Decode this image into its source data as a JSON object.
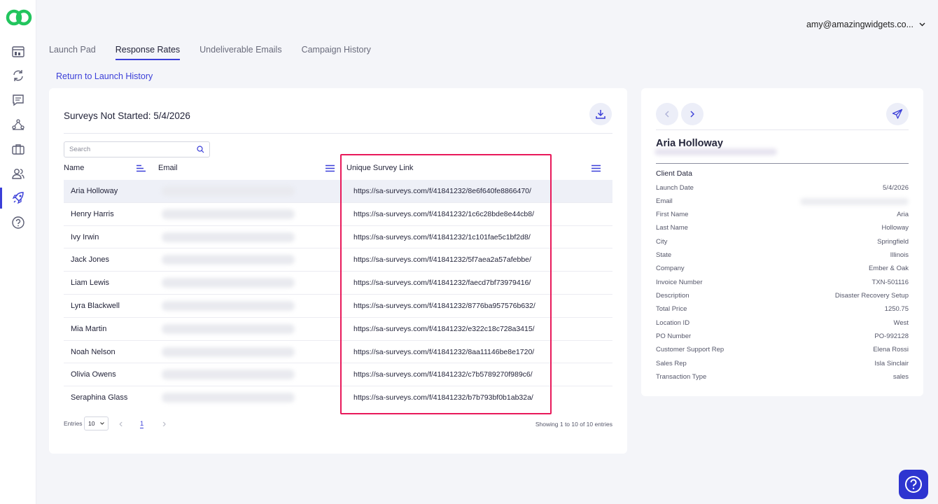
{
  "user": {
    "email": "amy@amazingwidgets.co..."
  },
  "nav": [
    "dashboard-icon",
    "sync-icon",
    "chat-icon",
    "network-icon",
    "briefcase-icon",
    "users-icon",
    "rocket-icon",
    "help-icon"
  ],
  "tabs": [
    {
      "label": "Launch Pad"
    },
    {
      "label": "Response Rates"
    },
    {
      "label": "Undeliverable Emails"
    },
    {
      "label": "Campaign History"
    }
  ],
  "return_link": "Return to Launch History",
  "main": {
    "title": "Surveys Not Started: 5/4/2026",
    "search_placeholder": "Search",
    "columns": {
      "name": "Name",
      "email": "Email",
      "link": "Unique Survey Link"
    },
    "rows": [
      {
        "name": "Aria Holloway",
        "link": "https://sa-surveys.com/f/41841232/8e6f640fe8866470/"
      },
      {
        "name": "Henry Harris",
        "link": "https://sa-surveys.com/f/41841232/1c6c28bde8e44cb8/"
      },
      {
        "name": "Ivy Irwin",
        "link": "https://sa-surveys.com/f/41841232/1c101fae5c1bf2d8/"
      },
      {
        "name": "Jack Jones",
        "link": "https://sa-surveys.com/f/41841232/5f7aea2a57afebbe/"
      },
      {
        "name": "Liam Lewis",
        "link": "https://sa-surveys.com/f/41841232/faecd7bf73979416/"
      },
      {
        "name": "Lyra Blackwell",
        "link": "https://sa-surveys.com/f/41841232/8776ba957576b632/"
      },
      {
        "name": "Mia Martin",
        "link": "https://sa-surveys.com/f/41841232/e322c18c728a3415/"
      },
      {
        "name": "Noah Nelson",
        "link": "https://sa-surveys.com/f/41841232/8aa11146be8e1720/"
      },
      {
        "name": "Olivia Owens",
        "link": "https://sa-surveys.com/f/41841232/c7b5789270f989c6/"
      },
      {
        "name": "Seraphina Glass",
        "link": "https://sa-surveys.com/f/41841232/b7b793bf0b1ab32a/"
      }
    ],
    "entries_label": "Entries",
    "entries_value": "10",
    "current_page": "1",
    "showing": "Showing 1 to 10 of 10 entries"
  },
  "side": {
    "name": "Aria Holloway",
    "section": "Client Data",
    "fields": [
      {
        "key": "Launch Date",
        "value": "5/4/2026"
      },
      {
        "key": "Email",
        "value": ""
      },
      {
        "key": "First Name",
        "value": "Aria"
      },
      {
        "key": "Last Name",
        "value": "Holloway"
      },
      {
        "key": "City",
        "value": "Springfield"
      },
      {
        "key": "State",
        "value": "Illinois"
      },
      {
        "key": "Company",
        "value": "Ember & Oak"
      },
      {
        "key": "Invoice Number",
        "value": "TXN-501116"
      },
      {
        "key": "Description",
        "value": "Disaster Recovery Setup"
      },
      {
        "key": "Total Price",
        "value": "1250.75"
      },
      {
        "key": "Location ID",
        "value": "West"
      },
      {
        "key": "PO Number",
        "value": "PO-992128"
      },
      {
        "key": "Customer Support Rep",
        "value": "Elena Rossi"
      },
      {
        "key": "Sales Rep",
        "value": "Isla Sinclair"
      },
      {
        "key": "Transaction Type",
        "value": "sales"
      }
    ]
  },
  "colors": {
    "accent": "#3b3fd8",
    "highlight": "#e8195a",
    "brand": "#22c55e",
    "fab": "#2d34d0"
  }
}
